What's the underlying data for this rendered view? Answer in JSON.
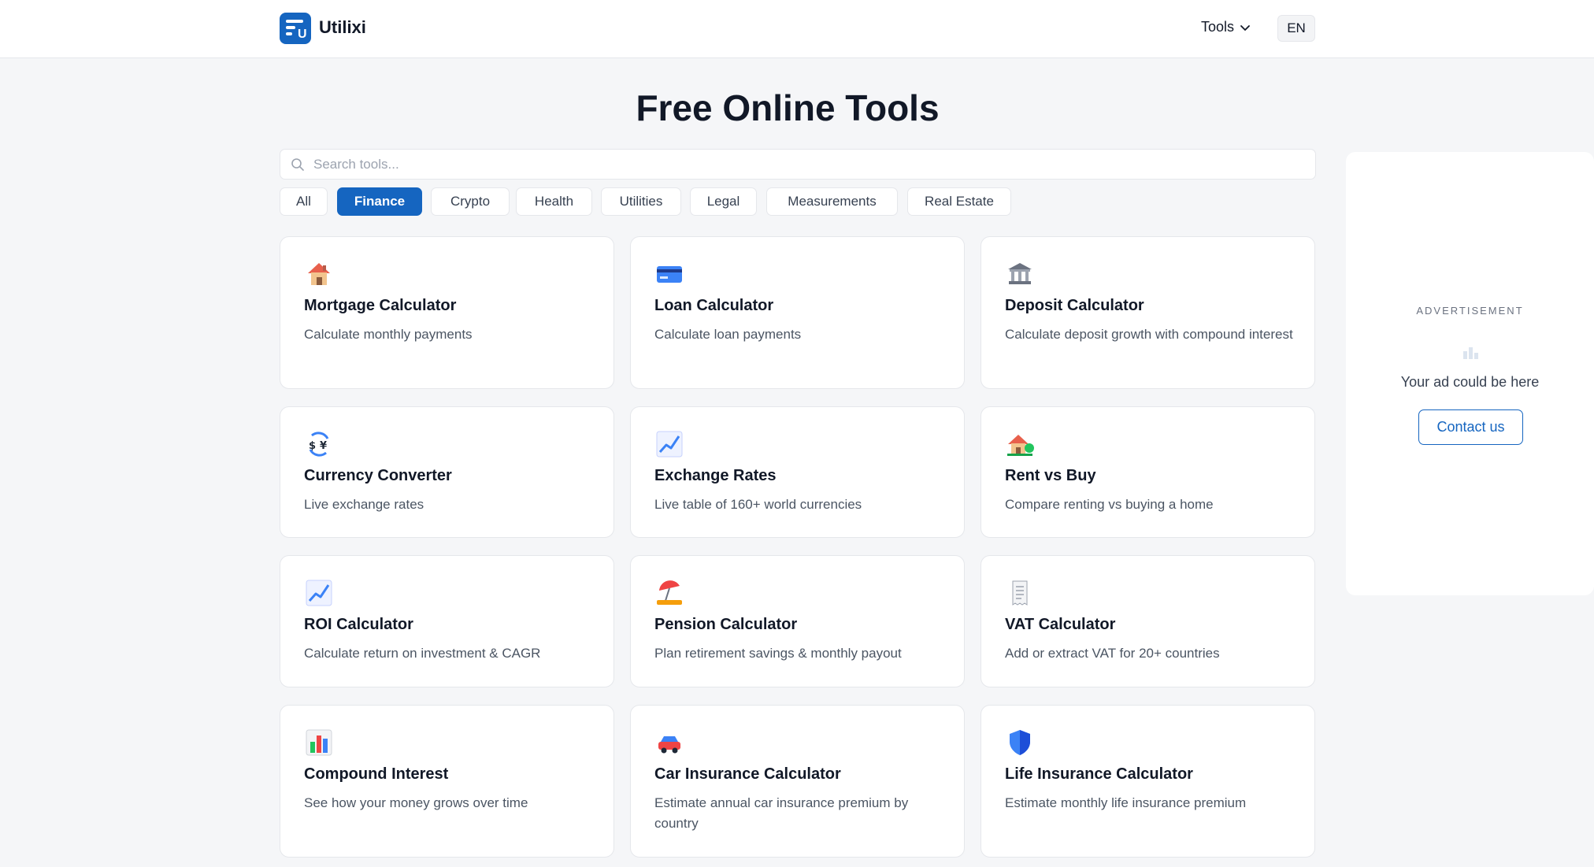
{
  "header": {
    "brand": "Utilixi",
    "logo_letter": "U",
    "tools_label": "Tools",
    "lang_label": "EN"
  },
  "main": {
    "title": "Free Online Tools",
    "search_placeholder": "Search tools..."
  },
  "filters": [
    "All",
    "Finance",
    "Crypto",
    "Health",
    "Utilities",
    "Legal",
    "Measurements",
    "Real Estate"
  ],
  "active_filter": "Finance",
  "cards": [
    {
      "title": "Mortgage Calculator",
      "desc": "Calculate monthly payments",
      "icon": "house-icon"
    },
    {
      "title": "Loan Calculator",
      "desc": "Calculate loan payments",
      "icon": "credit-card-icon"
    },
    {
      "title": "Deposit Calculator",
      "desc": "Calculate deposit growth with compound interest",
      "icon": "bank-icon"
    },
    {
      "title": "Currency Converter",
      "desc": "Live exchange rates",
      "icon": "currency-exchange-icon"
    },
    {
      "title": "Exchange Rates",
      "desc": "Live table of 160+ world currencies",
      "icon": "chart-increasing-icon"
    },
    {
      "title": "Rent vs Buy",
      "desc": "Compare renting vs buying a home",
      "icon": "house-with-garden-icon"
    },
    {
      "title": "ROI Calculator",
      "desc": "Calculate return on investment & CAGR",
      "icon": "chart-increasing-icon"
    },
    {
      "title": "Pension Calculator",
      "desc": "Plan retirement savings & monthly payout",
      "icon": "beach-umbrella-icon"
    },
    {
      "title": "VAT Calculator",
      "desc": "Add or extract VAT for 20+ countries",
      "icon": "receipt-icon"
    },
    {
      "title": "Compound Interest",
      "desc": "See how your money grows over time",
      "icon": "bar-chart-icon"
    },
    {
      "title": "Car Insurance Calculator",
      "desc": "Estimate annual car insurance premium by country",
      "icon": "car-icon"
    },
    {
      "title": "Life Insurance Calculator",
      "desc": "Estimate monthly life insurance premium",
      "icon": "shield-icon"
    }
  ],
  "ad": {
    "label": "ADVERTISEMENT",
    "text": "Your ad could be here",
    "button": "Contact us"
  },
  "colors": {
    "accent": "#1565c0",
    "background": "#f5f6f8",
    "card": "#ffffff"
  }
}
